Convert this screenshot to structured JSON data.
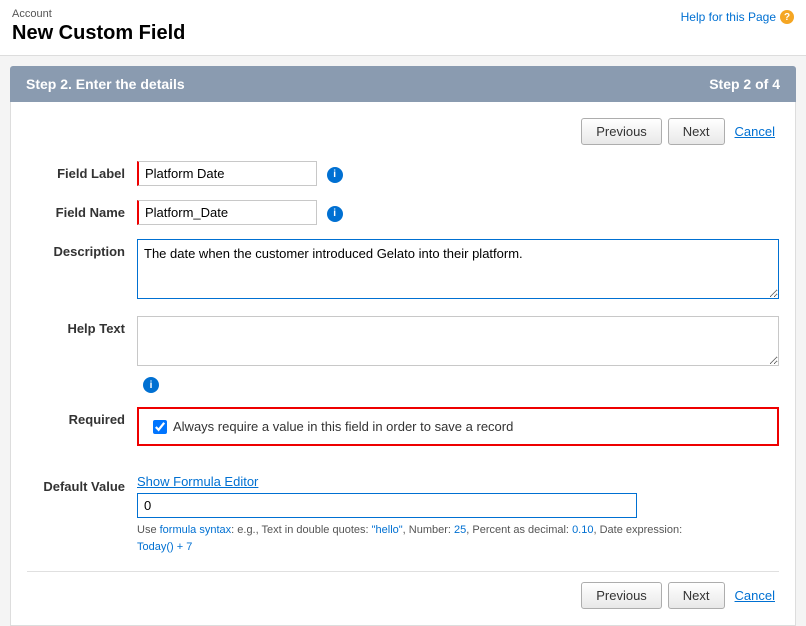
{
  "header": {
    "account_label": "Account",
    "page_title": "New Custom Field",
    "help_link_text": "Help for this Page",
    "help_icon": "?"
  },
  "step_bar": {
    "step_description": "Step 2. Enter the details",
    "step_indicator": "Step 2 of 4"
  },
  "buttons": {
    "previous": "Previous",
    "next": "Next",
    "cancel": "Cancel"
  },
  "form": {
    "field_label": {
      "label": "Field Label",
      "value": "Platform Date",
      "placeholder": ""
    },
    "field_name": {
      "label": "Field Name",
      "value": "Platform_Date",
      "placeholder": ""
    },
    "description": {
      "label": "Description",
      "value": "The date when the customer introduced Gelato into their platform.",
      "placeholder": ""
    },
    "help_text": {
      "label": "Help Text",
      "value": "",
      "placeholder": ""
    },
    "required": {
      "label": "Required",
      "checkbox_label": "Always require a value in this field in order to save a record",
      "checked": true
    },
    "default_value": {
      "label": "Default Value",
      "show_formula_link": "Show Formula Editor",
      "formula_value": "0",
      "hint_prefix": "Use ",
      "hint_formula_text": "formula syntax",
      "hint_middle": ": e.g., Text in double quotes: ",
      "hint_hello": "\"hello\"",
      "hint_number_label": ", Number: ",
      "hint_number": "25",
      "hint_percent_label": ", Percent as decimal: ",
      "hint_percent": "0.10",
      "hint_date_label": ", Date expression: ",
      "hint_date": "Today() + 7"
    }
  }
}
